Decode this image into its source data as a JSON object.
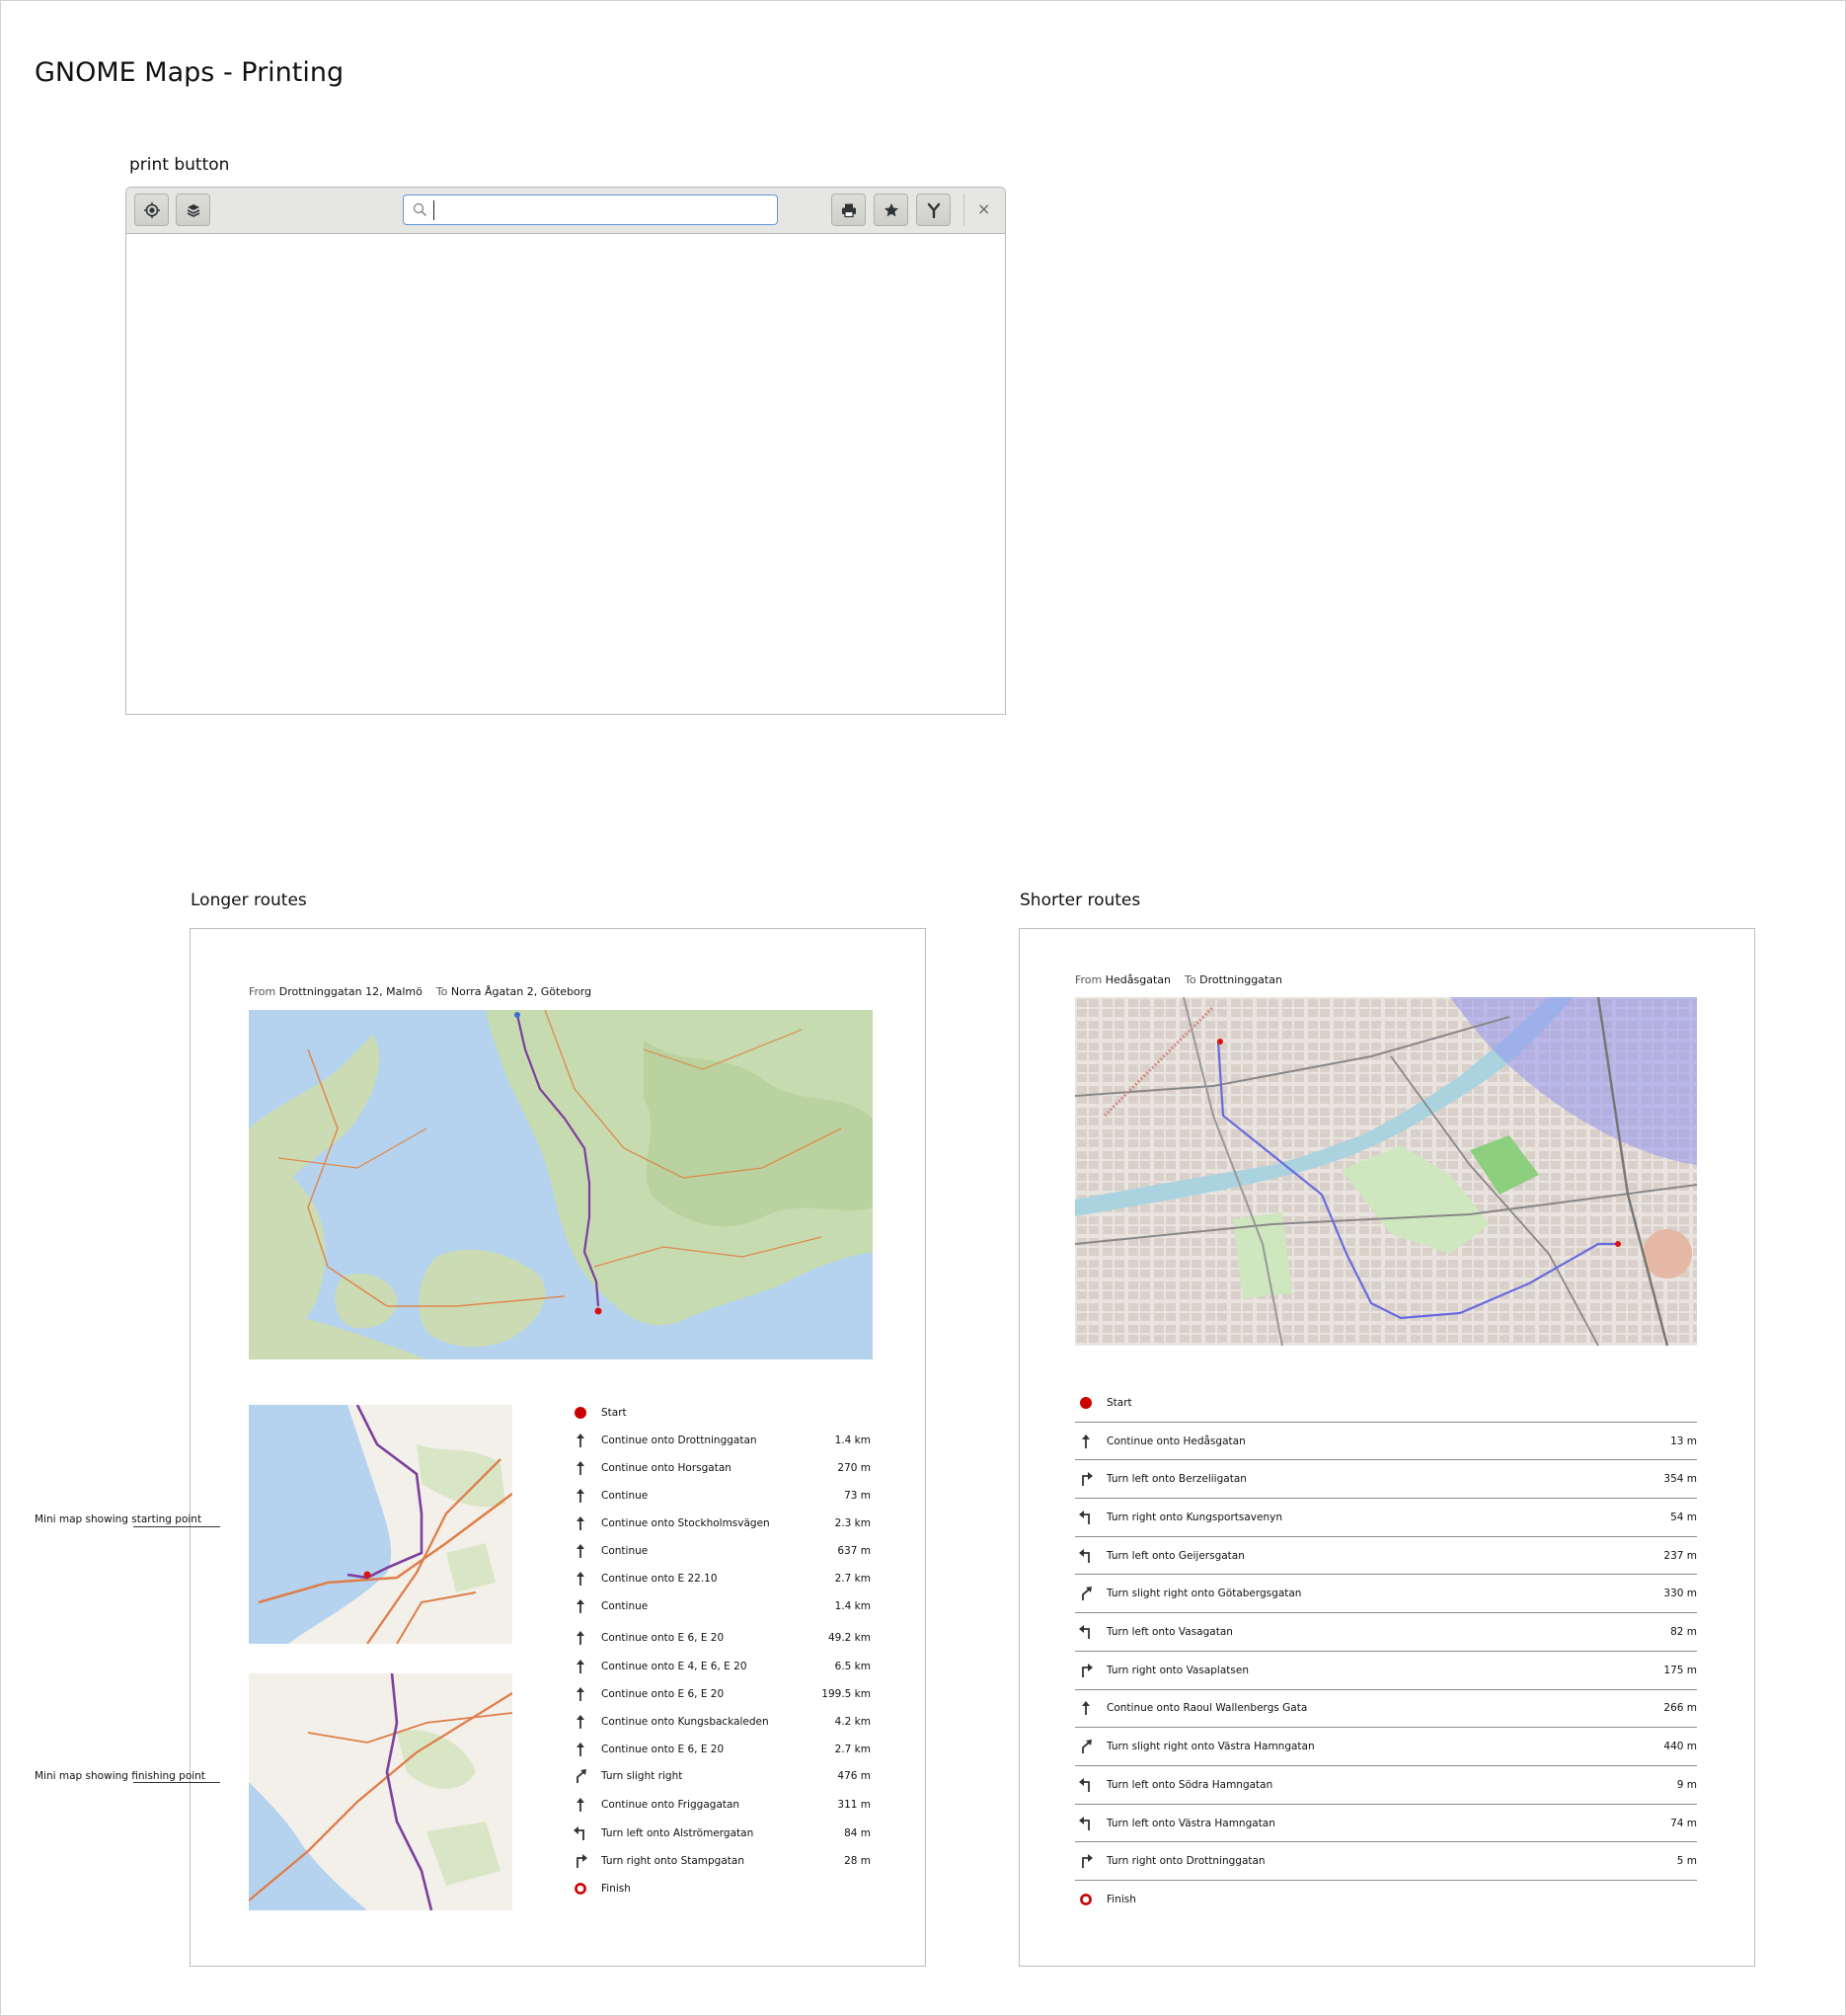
{
  "page_title": "GNOME Maps - Printing",
  "section_print_button": "print button",
  "headerbar": {
    "icons": [
      "location-icon",
      "layers-icon",
      "print-icon",
      "star-icon",
      "route-icon",
      "close-icon"
    ],
    "search_value": "",
    "close_glyph": "×"
  },
  "longer": {
    "heading": "Longer routes",
    "from_label": "From",
    "from_value": "Drottninggatan 12, Malmö",
    "to_label": "To",
    "to_value": "Norra Ågatan 2, Göteborg",
    "instructions": [
      {
        "icon": "start",
        "text": "Start",
        "dist": ""
      },
      {
        "icon": "straight",
        "text": "Continue onto Drottninggatan",
        "dist": "1.4 km"
      },
      {
        "icon": "straight",
        "text": "Continue onto Horsgatan",
        "dist": "270 m"
      },
      {
        "icon": "straight",
        "text": "Continue",
        "dist": "73 m"
      },
      {
        "icon": "straight",
        "text": "Continue onto Stockholmsvägen",
        "dist": "2.3 km"
      },
      {
        "icon": "straight",
        "text": "Continue",
        "dist": "637 m"
      },
      {
        "icon": "straight",
        "text": "Continue onto E 22.10",
        "dist": "2.7 km"
      },
      {
        "icon": "straight",
        "text": "Continue",
        "dist": "1.4 km"
      },
      {
        "icon": "straight",
        "text": "Continue onto E 6, E 20",
        "dist": "49.2 km"
      },
      {
        "icon": "straight",
        "text": "Continue onto E 4, E 6, E 20",
        "dist": "6.5 km"
      },
      {
        "icon": "straight",
        "text": "Continue onto E 6, E 20",
        "dist": "199.5 km"
      },
      {
        "icon": "straight",
        "text": "Continue onto Kungsbackaleden",
        "dist": "4.2 km"
      },
      {
        "icon": "straight",
        "text": "Continue onto E 6, E 20",
        "dist": "2.7 km"
      },
      {
        "icon": "slight-right",
        "text": "Turn slight right",
        "dist": "476 m"
      },
      {
        "icon": "straight",
        "text": "Continue onto Friggagatan",
        "dist": "311 m"
      },
      {
        "icon": "left",
        "text": "Turn left onto Alströmergatan",
        "dist": "84 m"
      },
      {
        "icon": "right",
        "text": "Turn right onto Stampgatan",
        "dist": "28 m"
      },
      {
        "icon": "finish",
        "text": "Finish",
        "dist": ""
      }
    ],
    "callout_start": "Mini map showing starting point",
    "callout_finish": "Mini map showing finishing point"
  },
  "shorter": {
    "heading": "Shorter routes",
    "from_label": "From",
    "from_value": "Hedåsgatan",
    "to_label": "To",
    "to_value": "Drottninggatan",
    "instructions": [
      {
        "icon": "start",
        "text": "Start",
        "dist": ""
      },
      {
        "icon": "straight",
        "text": "Continue onto Hedåsgatan",
        "dist": "13 m"
      },
      {
        "icon": "right",
        "text": "Turn left onto Berzeliigatan",
        "dist": "354 m"
      },
      {
        "icon": "left",
        "text": "Turn right onto Kungsportsavenyn",
        "dist": "54 m"
      },
      {
        "icon": "left",
        "text": "Turn left onto Geijersgatan",
        "dist": "237 m"
      },
      {
        "icon": "slight-right",
        "text": "Turn slight right onto Götabergsgatan",
        "dist": "330 m"
      },
      {
        "icon": "left",
        "text": "Turn left onto Vasagatan",
        "dist": "82 m"
      },
      {
        "icon": "right",
        "text": "Turn right onto Vasaplatsen",
        "dist": "175 m"
      },
      {
        "icon": "straight",
        "text": "Continue onto Raoul Wallenbergs Gata",
        "dist": "266 m"
      },
      {
        "icon": "slight-right",
        "text": "Turn slight right onto Västra Hamngatan",
        "dist": "440 m"
      },
      {
        "icon": "left",
        "text": "Turn left onto Södra Hamngatan",
        "dist": "9 m"
      },
      {
        "icon": "left",
        "text": "Turn left onto Västra Hamngatan",
        "dist": "74 m"
      },
      {
        "icon": "right",
        "text": "Turn right onto Drottninggatan",
        "dist": "5 m"
      },
      {
        "icon": "finish",
        "text": "Finish",
        "dist": ""
      }
    ]
  }
}
